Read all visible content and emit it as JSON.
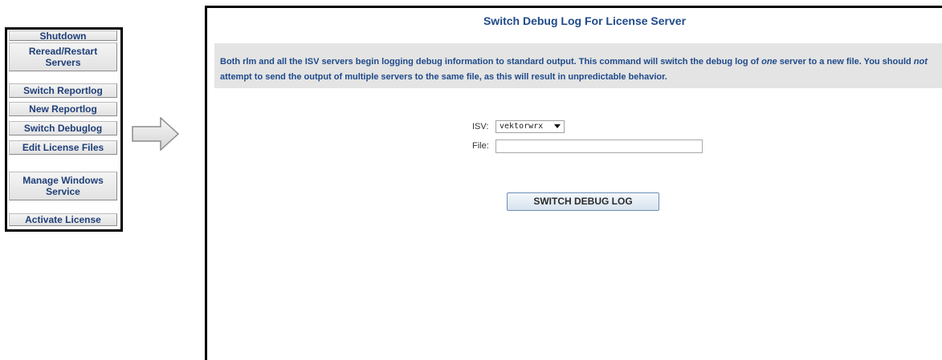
{
  "sidebar": {
    "items": [
      {
        "id": "shutdown",
        "label": "Shutdown"
      },
      {
        "id": "reread",
        "label_line1": "Reread/Restart",
        "label_line2": "Servers"
      },
      {
        "id": "switch-reportlog",
        "label": "Switch Reportlog"
      },
      {
        "id": "new-reportlog",
        "label": "New Reportlog"
      },
      {
        "id": "switch-debuglog",
        "label": "Switch Debuglog"
      },
      {
        "id": "edit-license-files",
        "label": "Edit License Files"
      },
      {
        "id": "manage-windows-service",
        "label_line1": "Manage Windows",
        "label_line2": "Service"
      },
      {
        "id": "activate-license",
        "label": "Activate License"
      }
    ]
  },
  "arrow": {
    "icon": "right-arrow-icon"
  },
  "main": {
    "title": "Switch Debug Log For License Server",
    "info": {
      "line1_before": "Both rlm and all the ISV servers begin logging debug information to standard output. This command will switch the debug log of ",
      "line1_em": "one",
      "line1_mid": " server to a new file. You should ",
      "line1_em2": "not",
      "line2": "attempt to send the output of multiple servers to the same file, as this will result in unpredictable behavior."
    },
    "form": {
      "isv_label": "ISV:",
      "isv_value": "vektorwrx",
      "file_label": "File:",
      "file_value": "",
      "submit_label": "SWITCH DEBUG LOG"
    }
  },
  "colors": {
    "title": "#1f4a8a",
    "menu_text": "#1f3f78",
    "info_bg": "#e4e4e4",
    "border": "#000000"
  }
}
